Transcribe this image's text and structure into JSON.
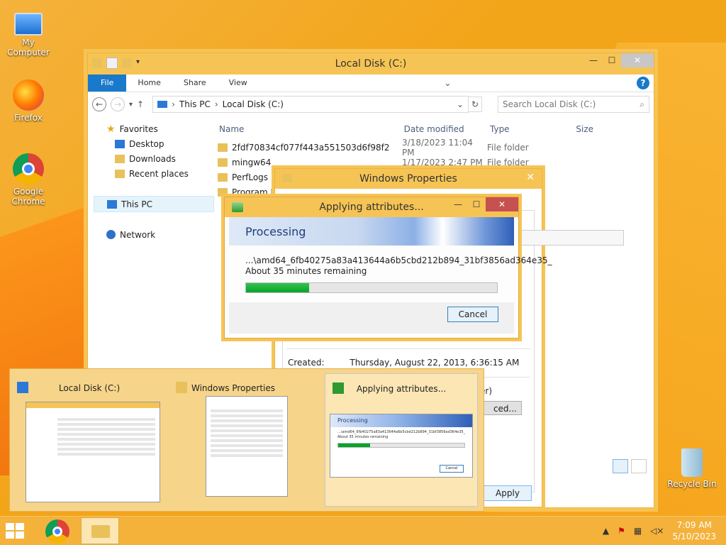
{
  "desktop": {
    "icons": [
      {
        "label": "My Computer"
      },
      {
        "label": "Firefox"
      },
      {
        "label": "Google Chrome"
      },
      {
        "label": "Recycle Bin"
      }
    ]
  },
  "explorer": {
    "title": "Local Disk (C:)",
    "ribbon_tabs": [
      "File",
      "Home",
      "Share",
      "View"
    ],
    "address": {
      "root": "This PC",
      "current": "Local Disk (C:)"
    },
    "search_placeholder": "Search Local Disk (C:)",
    "nav": {
      "favorites": "Favorites",
      "desktop": "Desktop",
      "downloads": "Downloads",
      "recent": "Recent places",
      "this_pc": "This PC",
      "network": "Network"
    },
    "columns": [
      "Name",
      "Date modified",
      "Type",
      "Size"
    ],
    "files": [
      {
        "name": "2fdf70834cf077f443a551503d6f98f2",
        "date": "3/18/2023 11:04 PM",
        "type": "File folder"
      },
      {
        "name": "mingw64",
        "date": "1/17/2023 2:47 PM",
        "type": "File folder"
      },
      {
        "name": "PerfLogs",
        "date": "",
        "type": ""
      },
      {
        "name": "Program Fi",
        "date": "",
        "type": ""
      }
    ]
  },
  "properties": {
    "title": "Windows Properties",
    "created_label": "Created:",
    "created_value": "Thursday, August 22, 2013, 6:36:15 AM",
    "hidden_fragment": "er)",
    "advanced_fragment": "ced...",
    "apply": "Apply"
  },
  "applying": {
    "title": "Applying attributes...",
    "banner": "Processing",
    "path": "...\\amd64_6fb40275a83a413644a6b5cbd212b894_31bf3856ad364e35_",
    "remaining": "About 35 minutes remaining",
    "progress": 0.25,
    "cancel": "Cancel"
  },
  "previews": [
    {
      "label": "Local Disk (C:)"
    },
    {
      "label": "Windows Properties"
    },
    {
      "label": "Applying attributes..."
    }
  ],
  "preview_thumb": {
    "banner": "Processing",
    "path": "...\\amd64_6fb40275a83a413644a6b5cbd212b894_31bf3856ad364e35_",
    "remaining": "About 35 minutes remaining",
    "cancel": "Cancel"
  },
  "taskbar": {
    "time": "7:09 AM",
    "date": "5/10/2023"
  }
}
